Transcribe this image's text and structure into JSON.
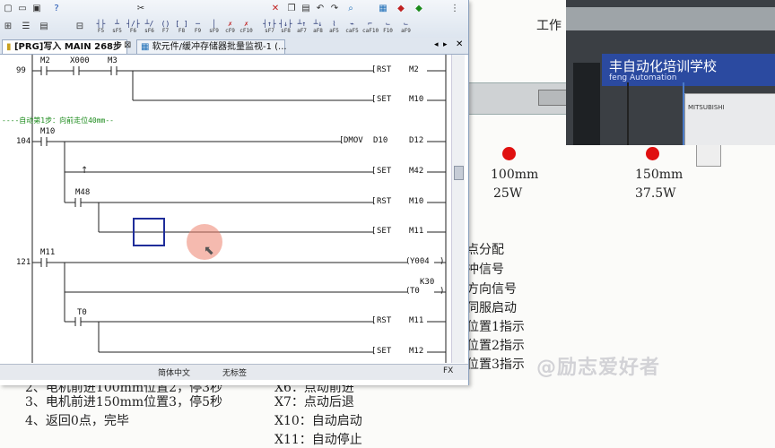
{
  "ladder": {
    "comment_row": "----自动第1步：向前走位40mm--",
    "rungs": [
      {
        "step": "99",
        "contacts": [
          "M2",
          "X000",
          "M3"
        ],
        "coils": [
          {
            "instr": "RST",
            "dev": "M2"
          },
          {
            "instr": "SET",
            "dev": "M10"
          }
        ]
      },
      {
        "step": "104",
        "contacts": [
          "M10"
        ],
        "coils": [
          {
            "instr": "DMOV",
            "arg1": "D10",
            "dev": "D12"
          },
          {
            "instr": "SET",
            "dev": "M42"
          },
          {
            "instr": "RST",
            "dev": "M10"
          },
          {
            "instr": "SET",
            "dev": "M11"
          }
        ],
        "branch_contact": "M48"
      },
      {
        "step": "121",
        "contacts": [
          "M11"
        ],
        "coils": [
          {
            "instr": "",
            "dev": "Y004"
          },
          {
            "instr": "",
            "dev": "T0",
            "const": "K30"
          },
          {
            "instr": "RST",
            "dev": "M11"
          },
          {
            "instr": "SET",
            "dev": "M12"
          }
        ],
        "branch_contact": "T0"
      }
    ]
  },
  "tabs": [
    {
      "label": "[PRG]写入 MAIN 268步"
    },
    {
      "label": "软元件/缓冲存储器批量监视-1 (..."
    }
  ],
  "fkeys": [
    "F5",
    "sF5",
    "F6",
    "sF6",
    "F7",
    "F8",
    "F9",
    "sF9",
    "cF9",
    "cF10",
    "sF7",
    "sF8",
    "aF7",
    "aF8",
    "aF5",
    "caF5",
    "caF10",
    "F10",
    "aF9"
  ],
  "status": {
    "lang": "简体中文",
    "title": "无标签",
    "right": "FX"
  },
  "slide": {
    "top_label": "工作",
    "positions": [
      {
        "mm": "100mm",
        "w": "25W"
      },
      {
        "mm": "150mm",
        "w": "37.5W"
      }
    ],
    "io_list": [
      "点分配",
      "冲信号",
      "方向信号",
      "伺服启动",
      "位置1指示",
      "位置2指示",
      "位置3指示"
    ],
    "steps": [
      "2、电机前进100mm位置2，停3秒",
      "3、电机前进150mm位置3，停5秒",
      "4、返回0点，完毕"
    ],
    "inputs": [
      "X6：点动前进",
      "X7：点动后退",
      "X10：自动启动",
      "X11：自动停止"
    ]
  },
  "watermark": "@励志爱好者",
  "camera": {
    "brand": "MITSUBISHI",
    "banner": "丰自动化培训学校",
    "banner_en": "feng Automation"
  },
  "colors": {
    "red": "#e01010",
    "accent": "#1f2d9a",
    "comment": "#1a8a1a"
  }
}
